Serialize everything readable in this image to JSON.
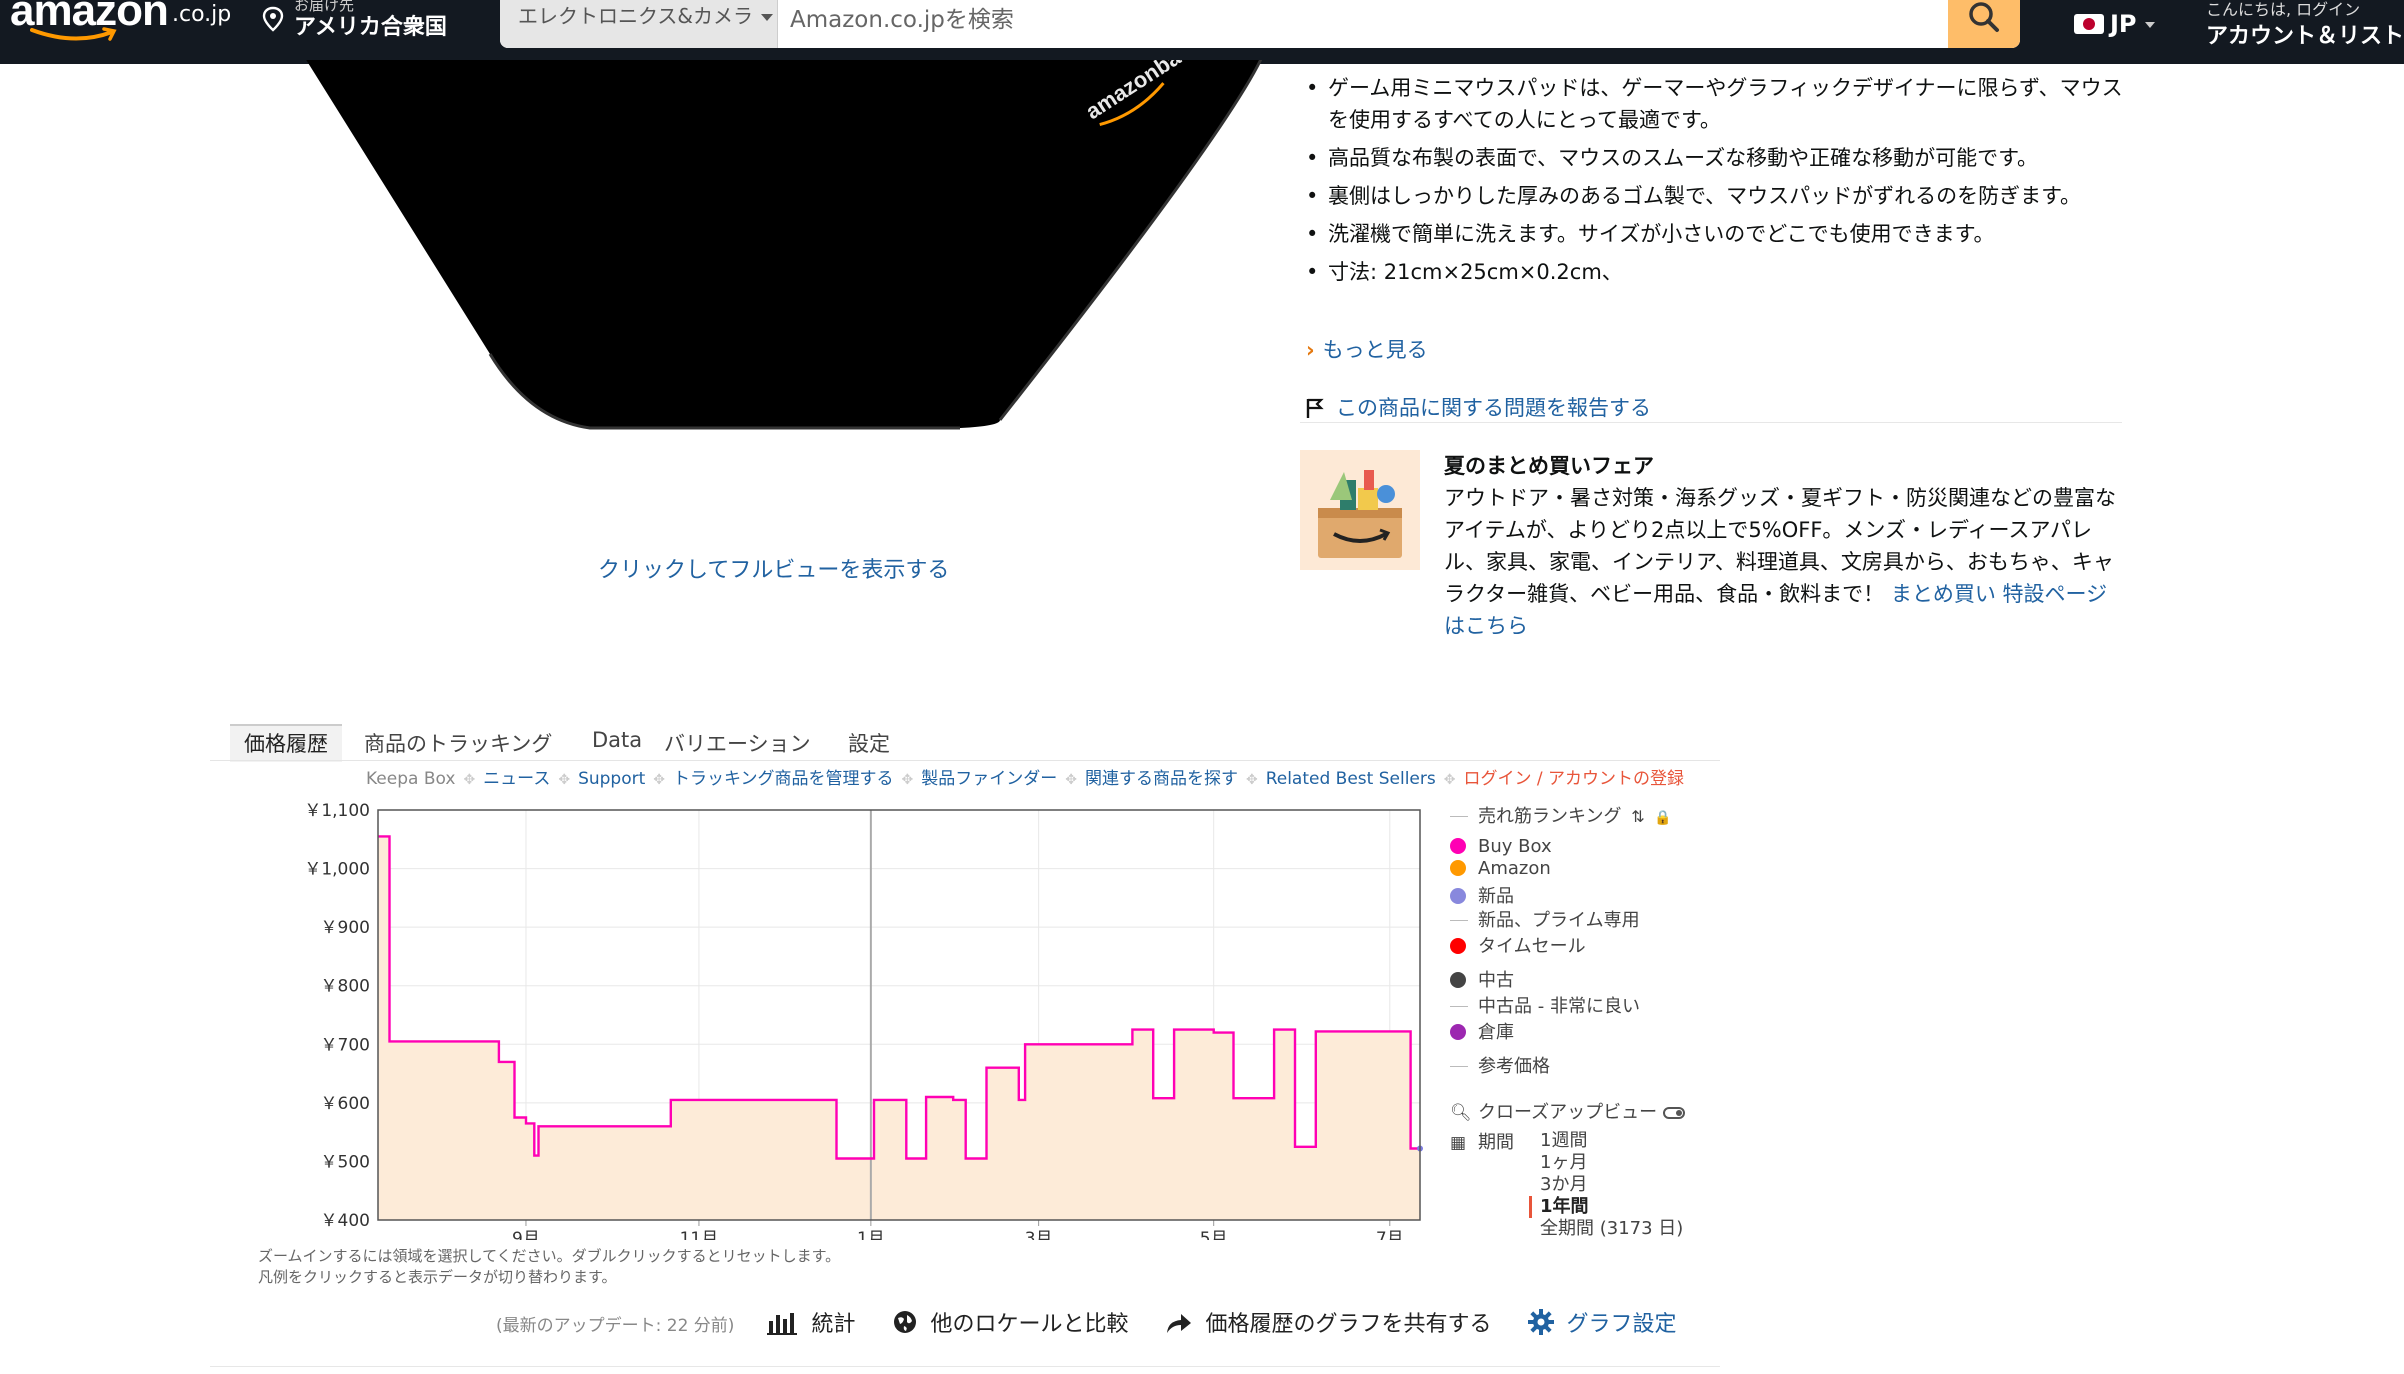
{
  "nav": {
    "logo_text": "amazon",
    "logo_suffix": ".co.jp",
    "deliver_small": "お届け先",
    "deliver_big": "アメリカ合衆国",
    "search_category": "エレクトロニクス&カメラ",
    "search_placeholder": "Amazon.co.jpを検索",
    "lang": "JP",
    "account_small": "こんにちは, ログイン",
    "account_big": "アカウント＆リスト"
  },
  "product": {
    "image_brand": "amazonbasics",
    "fullview_link": "クリックしてフルビューを表示する",
    "bullets": [
      "ゲーム用ミニマウスパッドは、ゲーマーやグラフィックデザイナーに限らず、マウスを使用するすべての人にとって最適です。",
      "高品質な布製の表面で、マウスのスムーズな移動や正確な移動が可能です。",
      "裏側はしっかりした厚みのあるゴム製で、マウスパッドがずれるのを防ぎます。",
      "洗濯機で簡単に洗えます。サイズが小さいのでどこでも使用できます。",
      "寸法: 21cm×25cm×0.2cm、"
    ],
    "see_more": "もっと見る",
    "report": "この商品に関する問題を報告する"
  },
  "promo": {
    "title": "夏のまとめ買いフェア",
    "body": "アウトドア・暑さ対策・海系グッズ・夏ギフト・防災関連などの豊富なアイテムが、よりどり2点以上で5%OFF。メンズ・レディースアパレル、家具、家電、インテリア、料理道具、文房具から、おもちゃ、キャラクター雑貨、ベビー用品、食品・飲料まで！",
    "link": "まとめ買い 特設ページはこちら"
  },
  "keepa": {
    "tabs": [
      "価格履歴",
      "商品のトラッキング",
      "Data",
      "バリエーション",
      "設定"
    ],
    "links_label": "Keepa Box",
    "links": [
      "ニュース",
      "Support",
      "トラッキング商品を管理する",
      "製品ファインダー",
      "関連する商品を探す",
      "Related Best Sellers"
    ],
    "login_link": "ログイン / アカウントの登録",
    "hint_line1": "ズームインするには領域を選択してください。ダブルクリックするとリセットします。",
    "hint_line2": "凡例をクリックすると表示データが切り替わります。",
    "legend": {
      "sales_rank": "売れ筋ランキング",
      "buy_box": "Buy Box",
      "amazon": "Amazon",
      "new": "新品",
      "new_prime": "新品、プライム専用",
      "lightning": "タイムセール",
      "used": "中古",
      "used_like_new": "中古品 - 非常に良い",
      "warehouse": "倉庫",
      "list_price": "参考価格",
      "closeup": "クローズアップビュー",
      "period": "期間"
    },
    "ranges": [
      "1週間",
      "1ヶ月",
      "3か月",
      "1年間",
      "全期間 (3173 日)"
    ],
    "selected_range": "1年間",
    "colors": {
      "buy_box": "#ff00b4",
      "amazon": "#ff9900",
      "new": "#8888dd",
      "lightning": "#ff0000",
      "used": "#444444",
      "warehouse": "#9c27b0",
      "area_fill": "#fdebd8"
    },
    "actions": {
      "updated": "(最新のアップデート: 22 分前)",
      "stats": "統計",
      "compare": "他のロケールと比較",
      "share": "価格履歴のグラフを共有する",
      "settings": "グラフ設定"
    }
  },
  "chart_data": {
    "type": "line",
    "title": "",
    "xlabel": "",
    "ylabel": "",
    "ylim": [
      400,
      1100
    ],
    "yticks": [
      400,
      500,
      600,
      700,
      800,
      900,
      1000,
      1100
    ],
    "ytick_labels": [
      "￥400",
      "￥500",
      "￥600",
      "￥700",
      "￥800",
      "￥900",
      "￥1,000",
      "￥1,100"
    ],
    "xlim": [
      0,
      100
    ],
    "xticks": [
      {
        "x": 14.2,
        "label": "9月"
      },
      {
        "x": 30.8,
        "label": "11月"
      },
      {
        "x": 47.3,
        "label": "1月"
      },
      {
        "x": 63.4,
        "label": "3月"
      },
      {
        "x": 80.2,
        "label": "5月"
      },
      {
        "x": 97.1,
        "label": "7月"
      }
    ],
    "divider_x": 47.3,
    "grid": true,
    "series": [
      {
        "name": "Buy Box",
        "step": true,
        "points": [
          [
            0,
            1055
          ],
          [
            1.1,
            1055
          ],
          [
            1.1,
            705
          ],
          [
            11.6,
            705
          ],
          [
            11.6,
            670
          ],
          [
            13.1,
            670
          ],
          [
            13.1,
            575
          ],
          [
            14.2,
            575
          ],
          [
            14.2,
            565
          ],
          [
            15.0,
            565
          ],
          [
            15.0,
            510
          ],
          [
            15.4,
            510
          ],
          [
            15.4,
            560
          ],
          [
            28.1,
            560
          ],
          [
            28.1,
            605
          ],
          [
            44.0,
            605
          ],
          [
            44.0,
            505
          ],
          [
            47.6,
            505
          ],
          [
            47.6,
            605
          ],
          [
            50.7,
            605
          ],
          [
            50.7,
            505
          ],
          [
            52.6,
            505
          ],
          [
            52.6,
            610
          ],
          [
            55.2,
            610
          ],
          [
            55.2,
            605
          ],
          [
            56.4,
            605
          ],
          [
            56.4,
            505
          ],
          [
            58.4,
            505
          ],
          [
            58.4,
            660
          ],
          [
            61.5,
            660
          ],
          [
            61.5,
            605
          ],
          [
            62.1,
            605
          ],
          [
            62.1,
            700
          ],
          [
            72.4,
            700
          ],
          [
            72.4,
            725
          ],
          [
            74.4,
            725
          ],
          [
            74.4,
            608
          ],
          [
            76.4,
            608
          ],
          [
            76.4,
            725
          ],
          [
            80.2,
            725
          ],
          [
            80.2,
            720
          ],
          [
            82.1,
            720
          ],
          [
            82.1,
            608
          ],
          [
            86.0,
            608
          ],
          [
            86.0,
            725
          ],
          [
            88.0,
            725
          ],
          [
            88.0,
            525
          ],
          [
            90.0,
            525
          ],
          [
            90.0,
            722
          ],
          [
            99.1,
            722
          ],
          [
            99.1,
            522
          ],
          [
            100,
            522
          ]
        ]
      }
    ]
  }
}
